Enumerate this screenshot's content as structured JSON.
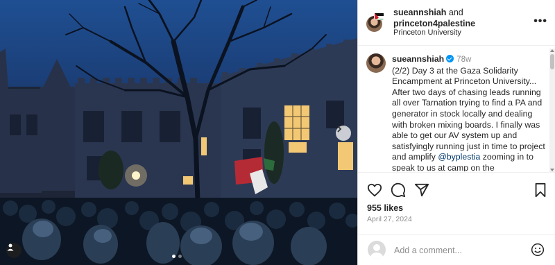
{
  "post": {
    "header": {
      "user1": "sueannshiah",
      "joiner": "and",
      "user2": "princeton4palestine",
      "location": "Princeton University",
      "more_label": "•••"
    },
    "caption": {
      "username": "sueannshiah",
      "time": "78w",
      "text_before_mention": "(2/2) Day 3 at the Gaza Solidarity Encampment at Princeton University... After two days of chasing leads running all over Tarnation trying to find a PA and generator in stock locally and dealing with broken mixing boards. I finally was able to get our AV system up and satisfyingly running just in time to project and amplify",
      "mention": "@byplestia",
      "text_after_mention": "zooming in to speak to us at camp on the"
    },
    "likes": "955 likes",
    "date": "April 27, 2024",
    "comment": {
      "placeholder": "Add a comment..."
    },
    "carousel": {
      "total": 2,
      "current": 1
    }
  },
  "icons": {
    "like": "heart-icon",
    "comment": "comment-bubble-icon",
    "share": "paper-plane-icon",
    "save": "bookmark-icon",
    "next": "chevron-right-icon",
    "tag": "person-icon",
    "emoji": "smiley-icon",
    "more": "more-horizontal-icon"
  },
  "colors": {
    "verified": "#0095f6",
    "mention": "#00376b",
    "muted": "#8e8e8e"
  }
}
